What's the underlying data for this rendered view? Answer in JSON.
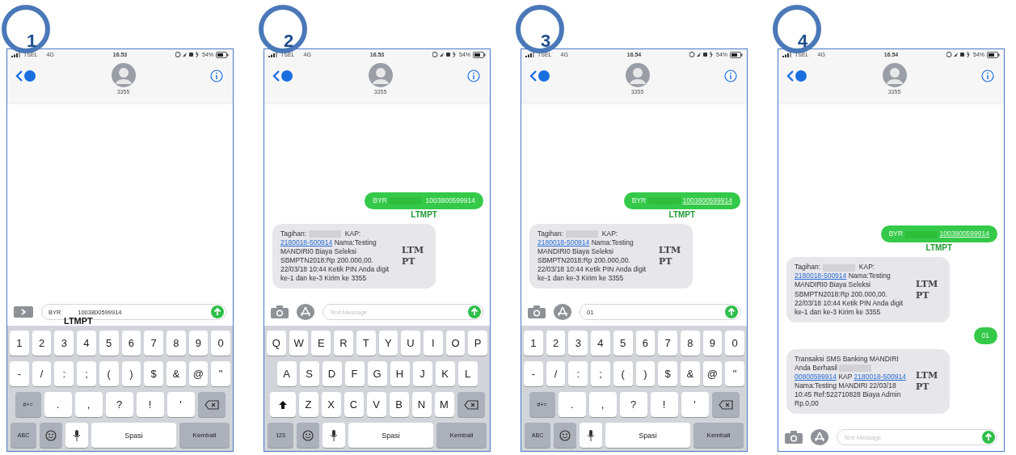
{
  "steps": [
    {
      "number": "1",
      "status_bar": {
        "carrier": "TSEL",
        "network": "4G",
        "time": "16.53",
        "battery": "54%"
      },
      "contact": {
        "name": "3355"
      },
      "composer": {
        "kind": "collapsed",
        "value": "BYR          1003800599914",
        "stamp": "LTMPT"
      },
      "keyboard": {
        "rows": [
          [
            {
              "kind": "char",
              "label": "1"
            },
            {
              "kind": "char",
              "label": "2"
            },
            {
              "kind": "char",
              "label": "3"
            },
            {
              "kind": "char",
              "label": "4"
            },
            {
              "kind": "char",
              "label": "5"
            },
            {
              "kind": "char",
              "label": "6"
            },
            {
              "kind": "char",
              "label": "7"
            },
            {
              "kind": "char",
              "label": "8"
            },
            {
              "kind": "char",
              "label": "9"
            },
            {
              "kind": "char",
              "label": "0"
            }
          ],
          [
            {
              "kind": "char",
              "label": "-"
            },
            {
              "kind": "char",
              "label": "/"
            },
            {
              "kind": "char",
              "label": ":"
            },
            {
              "kind": "char",
              "label": ";"
            },
            {
              "kind": "char",
              "label": "("
            },
            {
              "kind": "char",
              "label": ")"
            },
            {
              "kind": "char",
              "label": "$"
            },
            {
              "kind": "char",
              "label": "&"
            },
            {
              "kind": "char",
              "label": "@"
            },
            {
              "kind": "char",
              "label": "\""
            }
          ],
          [
            {
              "kind": "func",
              "label": "#+="
            },
            {
              "kind": "wide",
              "label": "."
            },
            {
              "kind": "wide",
              "label": ","
            },
            {
              "kind": "wide",
              "label": "?"
            },
            {
              "kind": "wide",
              "label": "!"
            },
            {
              "kind": "wide",
              "label": "'"
            },
            {
              "kind": "delete"
            }
          ]
        ],
        "mode_key": "ABC",
        "space_key": "Spasi",
        "return_key": "Kembali"
      }
    },
    {
      "number": "2",
      "status_bar": {
        "carrier": "TSEL",
        "network": "4G",
        "time": "16.53",
        "battery": "54%"
      },
      "contact": {
        "name": "3355"
      },
      "messages": [
        {
          "kind": "sent",
          "parts": [
            {
              "kind": "text",
              "text": "BYR "
            },
            {
              "kind": "redacted"
            },
            {
              "kind": "text",
              "text": " 1003800599914"
            }
          ],
          "stamp": "LTMPT"
        },
        {
          "kind": "received",
          "parts": [
            {
              "kind": "text",
              "text": "Tagihan: "
            },
            {
              "kind": "redacted"
            },
            {
              "kind": "text",
              "text": " KAP: "
            },
            {
              "kind": "link",
              "text": "2180018-500914"
            },
            {
              "kind": "text",
              "text": " Nama:Testing MANDIRI0 Biaya Seleksi SBMPTN2018:Rp 200.000,00. 22/03/18 10:44 Ketik PIN Anda digit ke-1 dan ke-3 Kirim ke 3355"
            }
          ],
          "stamp": "LTMPT"
        }
      ],
      "composer": {
        "kind": "full",
        "placeholder": "Text Message"
      },
      "keyboard": {
        "rows": [
          [
            {
              "kind": "char",
              "label": "Q"
            },
            {
              "kind": "char",
              "label": "W"
            },
            {
              "kind": "char",
              "label": "E"
            },
            {
              "kind": "char",
              "label": "R"
            },
            {
              "kind": "char",
              "label": "T"
            },
            {
              "kind": "char",
              "label": "Y"
            },
            {
              "kind": "char",
              "label": "U"
            },
            {
              "kind": "char",
              "label": "I"
            },
            {
              "kind": "char",
              "label": "O"
            },
            {
              "kind": "char",
              "label": "P"
            }
          ],
          [
            {
              "kind": "char",
              "label": "A"
            },
            {
              "kind": "char",
              "label": "S"
            },
            {
              "kind": "char",
              "label": "D"
            },
            {
              "kind": "char",
              "label": "F"
            },
            {
              "kind": "char",
              "label": "G"
            },
            {
              "kind": "char",
              "label": "H"
            },
            {
              "kind": "char",
              "label": "J"
            },
            {
              "kind": "char",
              "label": "K"
            },
            {
              "kind": "char",
              "label": "L"
            }
          ],
          [
            {
              "kind": "shift"
            },
            {
              "kind": "char",
              "label": "Z"
            },
            {
              "kind": "char",
              "label": "X"
            },
            {
              "kind": "char",
              "label": "C"
            },
            {
              "kind": "char",
              "label": "V"
            },
            {
              "kind": "char",
              "label": "B"
            },
            {
              "kind": "char",
              "label": "N"
            },
            {
              "kind": "char",
              "label": "M"
            },
            {
              "kind": "delete"
            }
          ]
        ],
        "mode_key": "123",
        "space_key": "Spasi",
        "return_key": "Kembali"
      }
    },
    {
      "number": "3",
      "status_bar": {
        "carrier": "TSEL",
        "network": "4G",
        "time": "16.54",
        "battery": "54%"
      },
      "contact": {
        "name": "3355"
      },
      "messages": [
        {
          "kind": "sent",
          "parts": [
            {
              "kind": "text",
              "text": "BYR "
            },
            {
              "kind": "redacted"
            },
            {
              "kind": "link",
              "text": "1003800599914"
            }
          ],
          "stamp": "LTMPT"
        },
        {
          "kind": "received",
          "parts": [
            {
              "kind": "text",
              "text": "Tagihan: "
            },
            {
              "kind": "redacted"
            },
            {
              "kind": "text",
              "text": " KAP: "
            },
            {
              "kind": "link",
              "text": "2180018-500914"
            },
            {
              "kind": "text",
              "text": " Nama:Testing MANDIRI0 Biaya Seleksi SBMPTN2018:Rp 200.000,00. 22/03/18 10:44 Ketik PIN Anda digit ke-1 dan ke-3 Kirim ke 3355"
            }
          ],
          "stamp": "LTMPT"
        }
      ],
      "composer": {
        "kind": "full",
        "value": "01"
      },
      "keyboard": {
        "rows": [
          [
            {
              "kind": "char",
              "label": "1"
            },
            {
              "kind": "char",
              "label": "2"
            },
            {
              "kind": "char",
              "label": "3"
            },
            {
              "kind": "char",
              "label": "4"
            },
            {
              "kind": "char",
              "label": "5"
            },
            {
              "kind": "char",
              "label": "6"
            },
            {
              "kind": "char",
              "label": "7"
            },
            {
              "kind": "char",
              "label": "8"
            },
            {
              "kind": "char",
              "label": "9"
            },
            {
              "kind": "char",
              "label": "0"
            }
          ],
          [
            {
              "kind": "char",
              "label": "-"
            },
            {
              "kind": "char",
              "label": "/"
            },
            {
              "kind": "char",
              "label": ":"
            },
            {
              "kind": "char",
              "label": ";"
            },
            {
              "kind": "char",
              "label": "("
            },
            {
              "kind": "char",
              "label": ")"
            },
            {
              "kind": "char",
              "label": "$"
            },
            {
              "kind": "char",
              "label": "&"
            },
            {
              "kind": "char",
              "label": "@"
            },
            {
              "kind": "char",
              "label": "\""
            }
          ],
          [
            {
              "kind": "func",
              "label": "#+="
            },
            {
              "kind": "wide",
              "label": "."
            },
            {
              "kind": "wide",
              "label": ","
            },
            {
              "kind": "wide",
              "label": "?"
            },
            {
              "kind": "wide",
              "label": "!"
            },
            {
              "kind": "wide",
              "label": "'"
            },
            {
              "kind": "delete"
            }
          ]
        ],
        "mode_key": "ABC",
        "space_key": "Spasi",
        "return_key": "Kembali"
      }
    },
    {
      "number": "4",
      "status_bar": {
        "carrier": "TSEL",
        "network": "4G",
        "time": "16.54",
        "battery": "54%"
      },
      "contact": {
        "name": "3355"
      },
      "messages": [
        {
          "kind": "sent",
          "parts": [
            {
              "kind": "text",
              "text": "BYR "
            },
            {
              "kind": "redacted"
            },
            {
              "kind": "link",
              "text": "1003800599914"
            }
          ],
          "stamp": "LTMPT"
        },
        {
          "kind": "received",
          "parts": [
            {
              "kind": "text",
              "text": "Tagihan: "
            },
            {
              "kind": "redacted"
            },
            {
              "kind": "text",
              "text": " KAP: "
            },
            {
              "kind": "link",
              "text": "2180018-500914"
            },
            {
              "kind": "text",
              "text": " Nama:Testing MANDIRI0 Biaya Seleksi SBMPTN2018:Rp 200.000,00. 22/03/18 10:44 Ketik PIN Anda digit ke-1 dan ke-3 Kirim ke 3355"
            }
          ],
          "stamp": "LTMPT"
        },
        {
          "kind": "sent",
          "parts": [
            {
              "kind": "text",
              "text": "01"
            }
          ]
        },
        {
          "kind": "received",
          "parts": [
            {
              "kind": "text",
              "text": "Transaksi SMS Banking MANDIRI Anda Berhasil "
            },
            {
              "kind": "redacted"
            },
            {
              "kind": "link",
              "text": "00800599914"
            },
            {
              "kind": "text",
              "text": " KAP "
            },
            {
              "kind": "link",
              "text": "2180018-500914"
            },
            {
              "kind": "text",
              "text": " Nama:Testing MANDIRI 22/03/18 10:45 Ref:522710828 Biaya Admin Rp.0,00"
            }
          ],
          "stamp": "LTMPT"
        }
      ],
      "composer": {
        "kind": "full",
        "placeholder": "Text Message"
      }
    }
  ]
}
